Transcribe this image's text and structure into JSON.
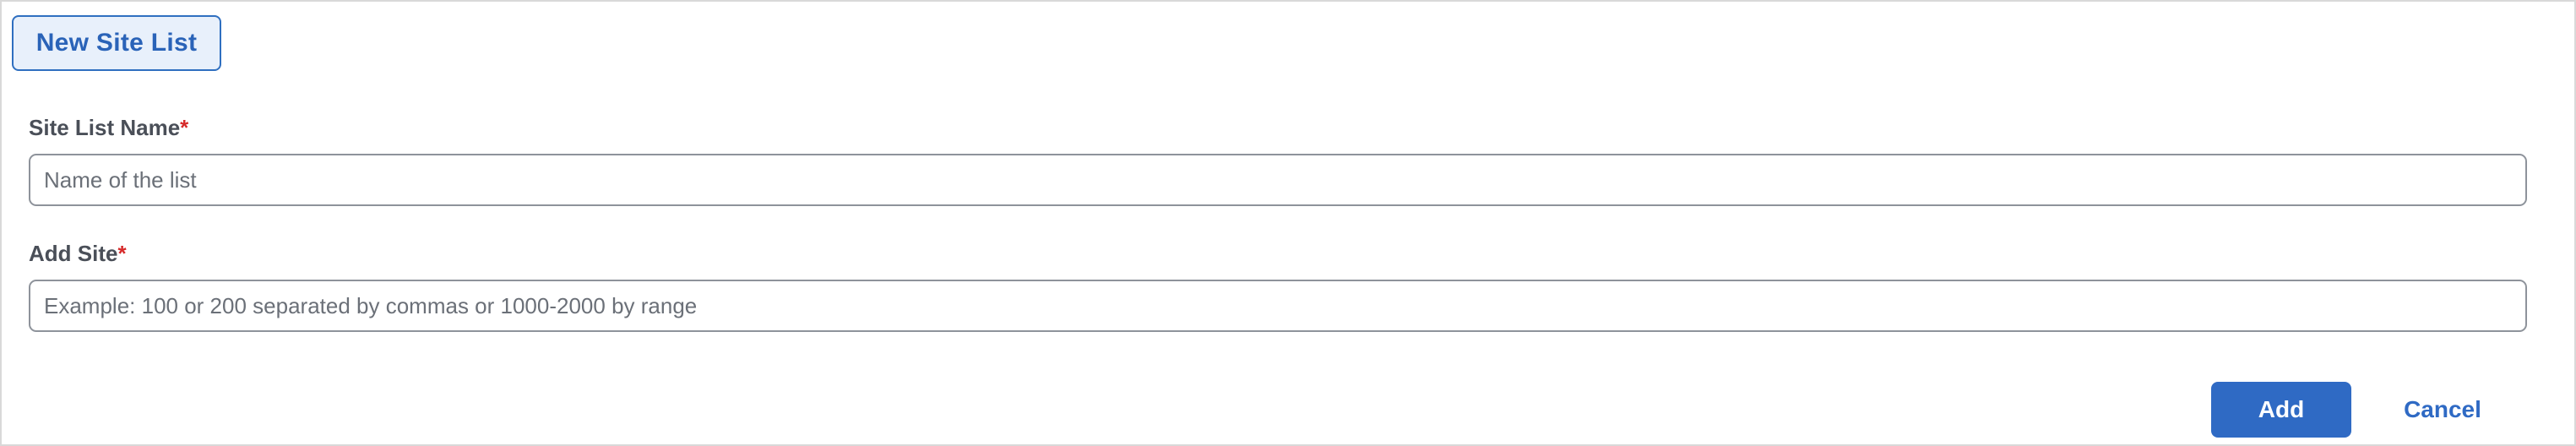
{
  "header": {
    "title": "New Site List"
  },
  "form": {
    "site_list_name": {
      "label": "Site List Name",
      "required_marker": "*",
      "value": "",
      "placeholder": "Name of the list"
    },
    "add_site": {
      "label": "Add Site",
      "required_marker": "*",
      "value": "",
      "placeholder": "Example: 100 or 200 separated by commas or 1000-2000 by range"
    }
  },
  "actions": {
    "add_label": "Add",
    "cancel_label": "Cancel"
  },
  "colors": {
    "accent": "#2f6ac4",
    "required": "#d62a2a",
    "tab_background": "#e8f0fb",
    "label_text": "#4a4f58",
    "input_border": "#8e939b"
  }
}
